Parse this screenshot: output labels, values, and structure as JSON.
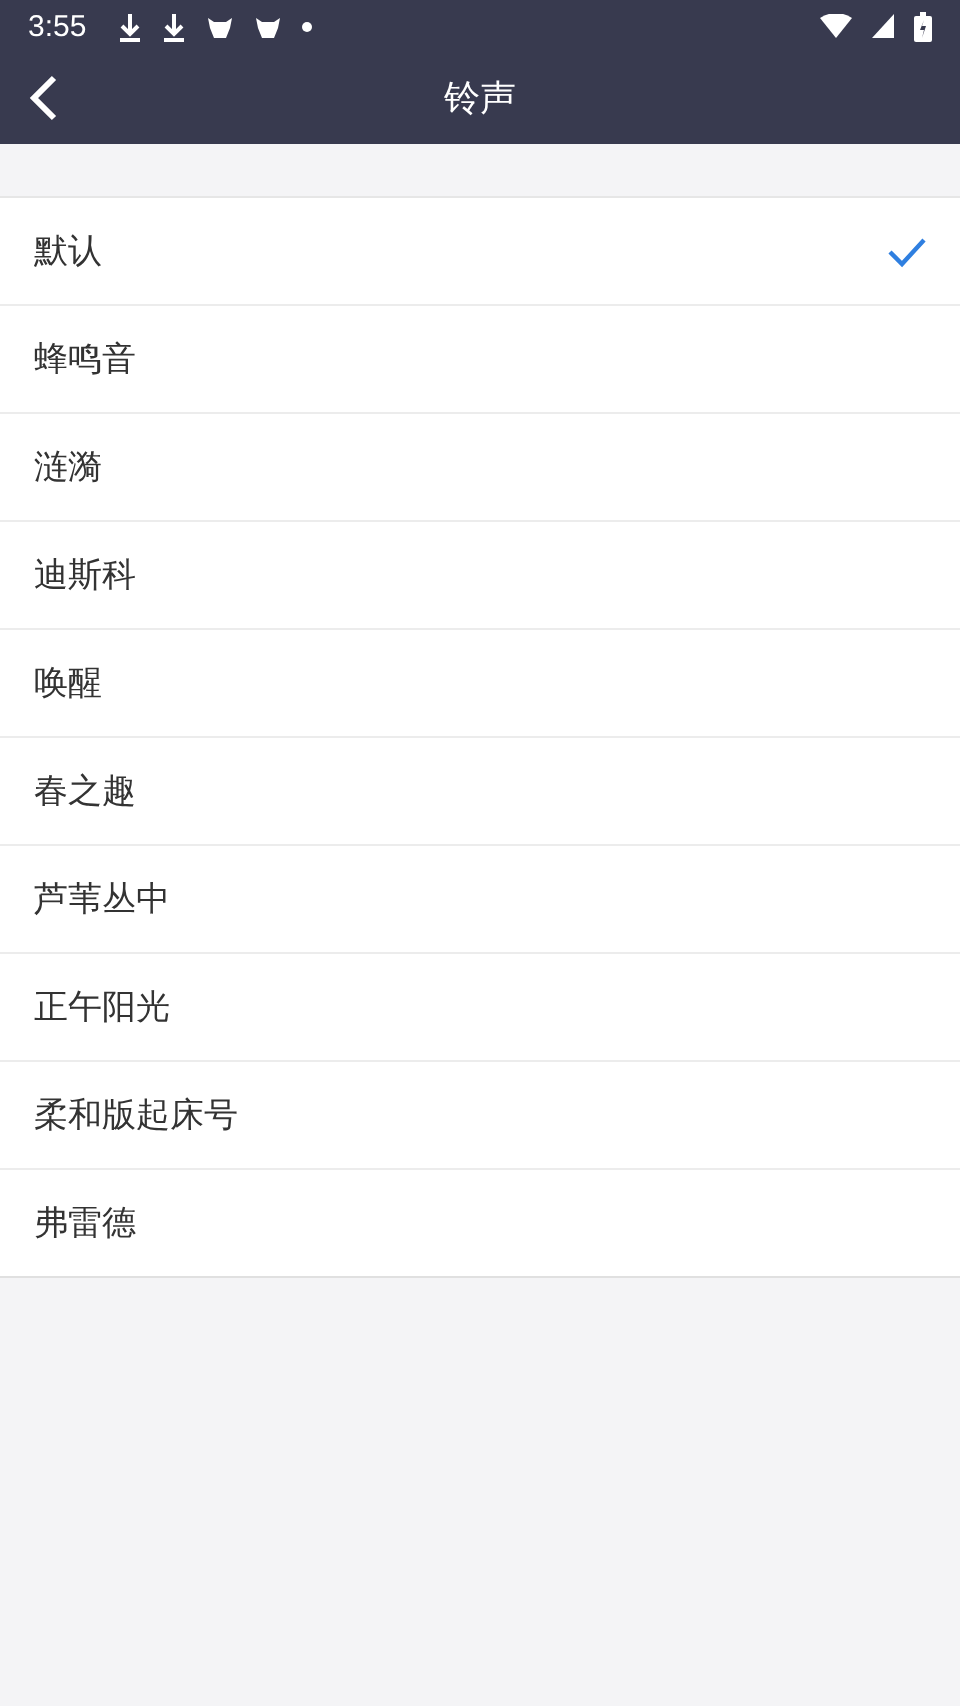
{
  "status_bar": {
    "time": "3:55"
  },
  "header": {
    "title": "铃声"
  },
  "ringtones": [
    {
      "label": "默认",
      "selected": true
    },
    {
      "label": "蜂鸣音",
      "selected": false
    },
    {
      "label": "涟漪",
      "selected": false
    },
    {
      "label": "迪斯科",
      "selected": false
    },
    {
      "label": "唤醒",
      "selected": false
    },
    {
      "label": "春之趣",
      "selected": false
    },
    {
      "label": "芦苇丛中",
      "selected": false
    },
    {
      "label": "正午阳光",
      "selected": false
    },
    {
      "label": "柔和版起床号",
      "selected": false
    },
    {
      "label": "弗雷德",
      "selected": false
    }
  ]
}
